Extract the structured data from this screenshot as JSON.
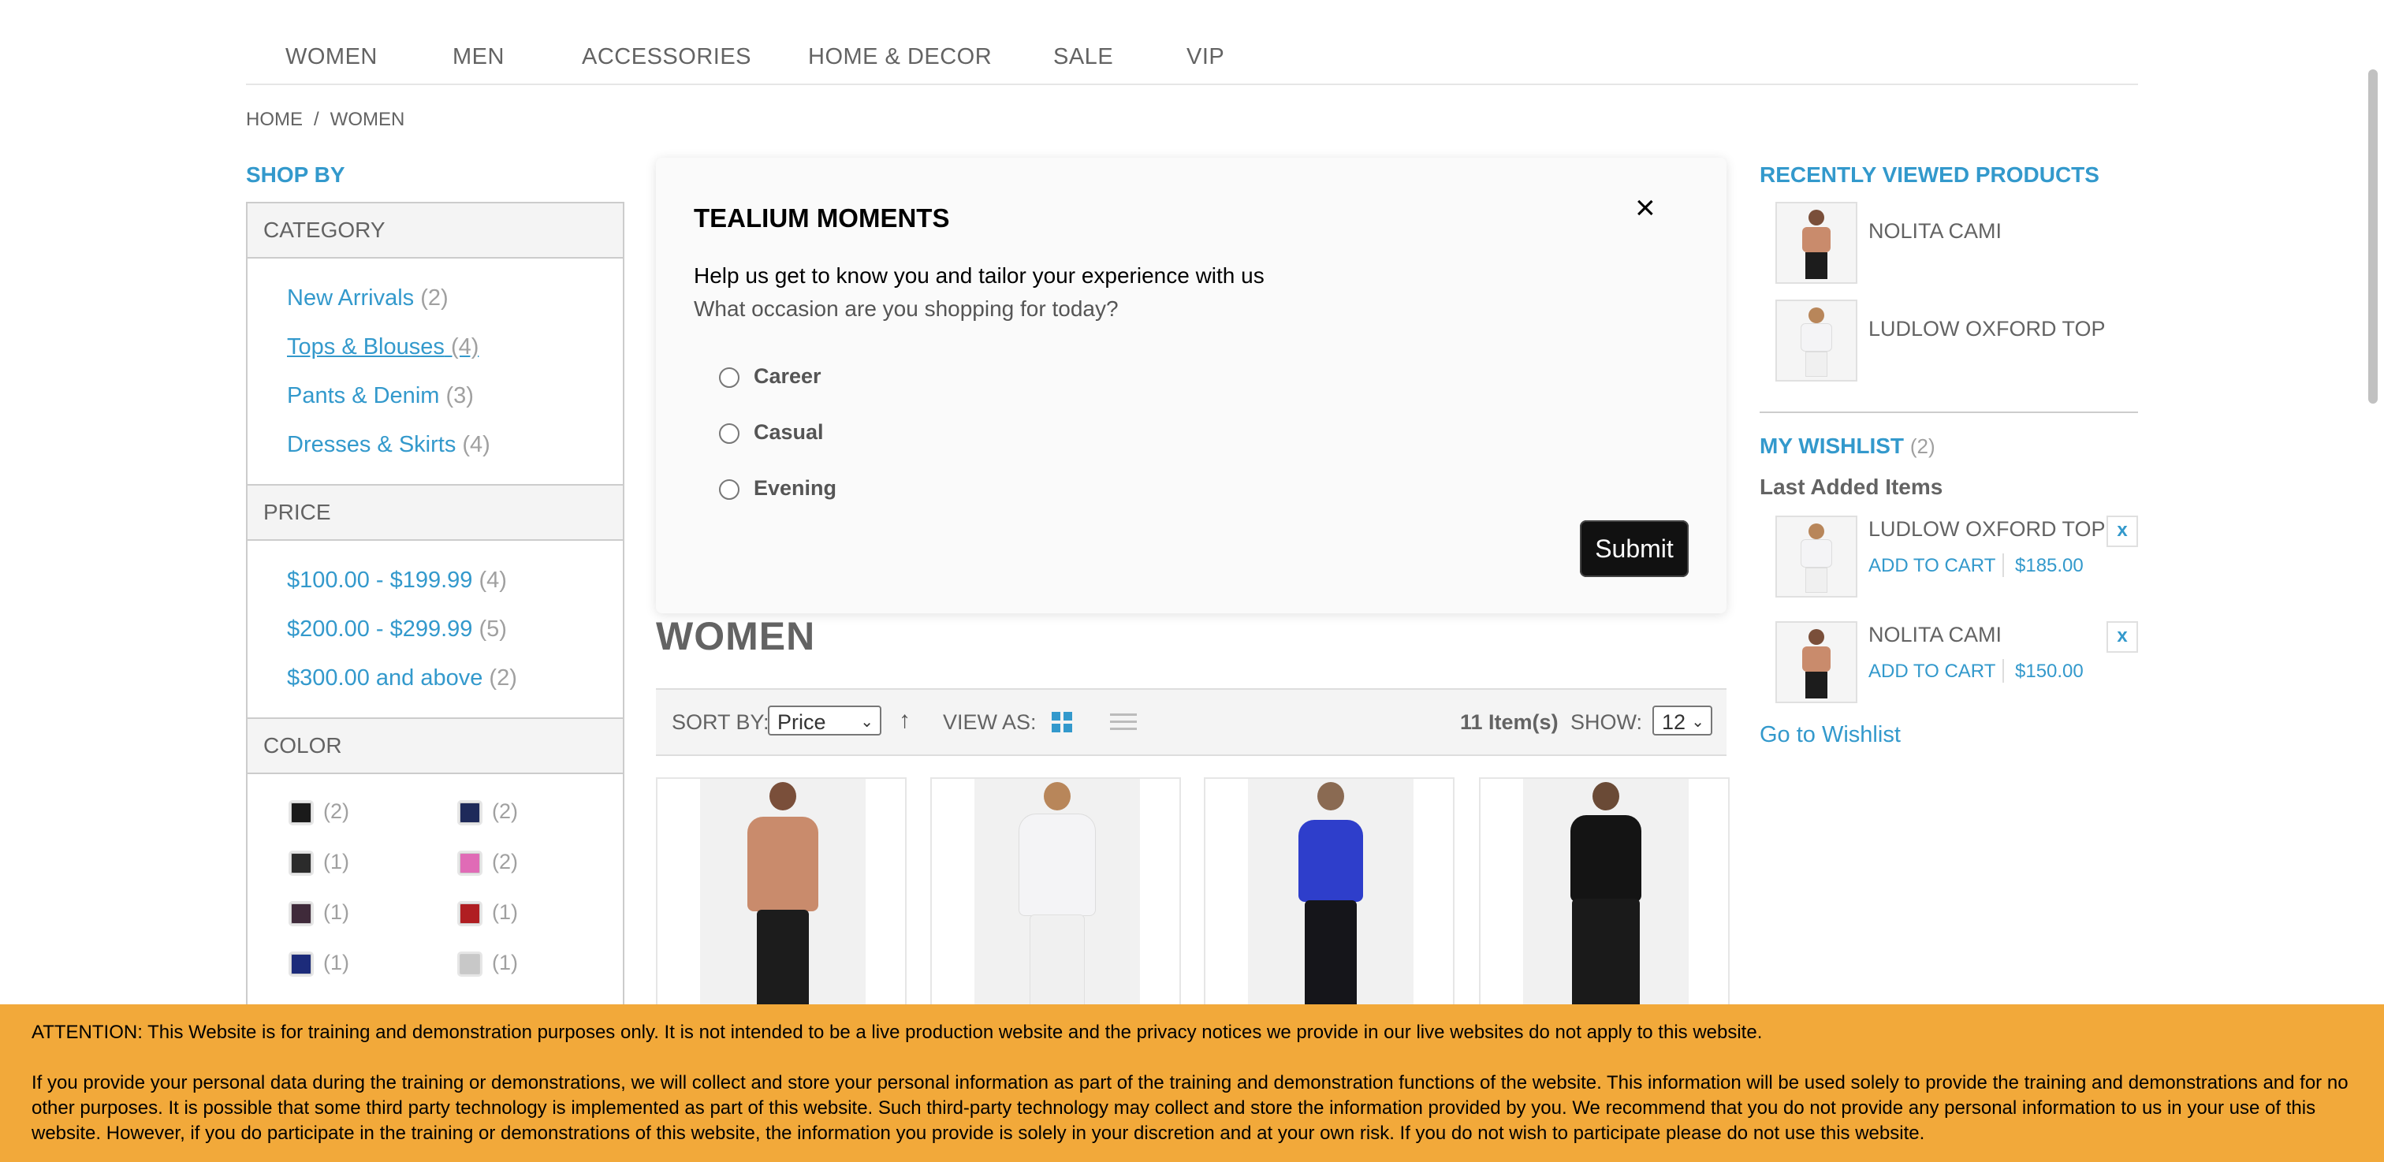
{
  "nav": {
    "items": [
      "WOMEN",
      "MEN",
      "ACCESSORIES",
      "HOME & DECOR",
      "SALE",
      "VIP"
    ]
  },
  "breadcrumb": {
    "home": "HOME",
    "separator": "/",
    "current": "WOMEN"
  },
  "sidebar": {
    "title": "SHOP BY",
    "category": {
      "heading": "CATEGORY",
      "items": [
        {
          "label": "New Arrivals",
          "count": "(2)"
        },
        {
          "label": "Tops & Blouses",
          "count": "(4)"
        },
        {
          "label": "Pants & Denim",
          "count": "(3)"
        },
        {
          "label": "Dresses & Skirts",
          "count": "(4)"
        }
      ]
    },
    "price": {
      "heading": "PRICE",
      "items": [
        {
          "label": "$100.00 - $199.99",
          "count": "(4)"
        },
        {
          "label": "$200.00 - $299.99",
          "count": "(5)"
        },
        {
          "label": "$300.00 and above",
          "count": "(2)"
        }
      ]
    },
    "color": {
      "heading": "COLOR",
      "swatches": [
        {
          "color": "#1a1a1a",
          "count": "(2)"
        },
        {
          "color": "#1e2a5a",
          "count": "(2)"
        },
        {
          "color": "#2b2b2b",
          "count": "(1)"
        },
        {
          "color": "#e06bb6",
          "count": "(2)"
        },
        {
          "color": "#3f2a3a",
          "count": "(1)"
        },
        {
          "color": "#b01e22",
          "count": "(1)"
        },
        {
          "color": "#1c2b7a",
          "count": "(1)"
        },
        {
          "color": "#c8c8c8",
          "count": "(1)"
        }
      ]
    }
  },
  "modal": {
    "title": "TEALIUM MOMENTS",
    "close": "×",
    "intro": "Help us get to know you and tailor your experience with us",
    "question": "What occasion are you shopping for today?",
    "options": [
      "Career",
      "Casual",
      "Evening"
    ],
    "submit": "Submit"
  },
  "category_title": "WOMEN",
  "toolbar": {
    "sort_label": "SORT BY:",
    "sort_value": "Price",
    "sort_dir_icon": "↑",
    "view_label": "VIEW AS:",
    "item_count": "11 Item(s)",
    "show_label": "SHOW:",
    "show_value": "12"
  },
  "products": [
    {
      "name": "nolita-cami",
      "top_color": "#c98b6c",
      "bottom_color": "#1c1c1c"
    },
    {
      "name": "ludlow-oxford-top",
      "top_color": "#f4f4f6",
      "bottom_color": "#f0f0f0"
    },
    {
      "name": "cami-blue",
      "top_color": "#2e3ecb",
      "bottom_color": "#15151a"
    },
    {
      "name": "black-dress",
      "top_color": "#141414",
      "bottom_color": "#1a1a1a"
    }
  ],
  "recently_viewed": {
    "title": "RECENTLY VIEWED PRODUCTS",
    "items": [
      "NOLITA CAMI",
      "LUDLOW OXFORD TOP"
    ]
  },
  "wishlist": {
    "title": "MY WISHLIST",
    "count": "(2)",
    "subtitle": "Last Added Items",
    "items": [
      {
        "name": "LUDLOW OXFORD TOP",
        "add_to_cart": "ADD TO CART",
        "price": "$185.00",
        "remove": "x"
      },
      {
        "name": "NOLITA CAMI",
        "add_to_cart": "ADD TO CART",
        "price": "$150.00",
        "remove": "x"
      }
    ],
    "go_link": "Go to Wishlist"
  },
  "notice": {
    "line1": "ATTENTION: This Website is for training and demonstration purposes only. It is not intended to be a live production website and the privacy notices we provide in our live websites do not apply to this website.",
    "line2": "If you provide your personal data during the training or demonstrations, we will collect and store your personal information as part of the training and demonstration functions of the website. This information will be used solely to provide the training and demonstrations and for no other purposes. It is possible that some third party technology is implemented as part of this website. Such third-party technology may collect and store the information provided by you. We recommend that you do not provide any personal information to us in your use of this website. However, if you do participate in the training or demonstrations of this website, the information you provide is solely in your discretion and at your own risk. If you do not wish to participate please do not use this website."
  }
}
